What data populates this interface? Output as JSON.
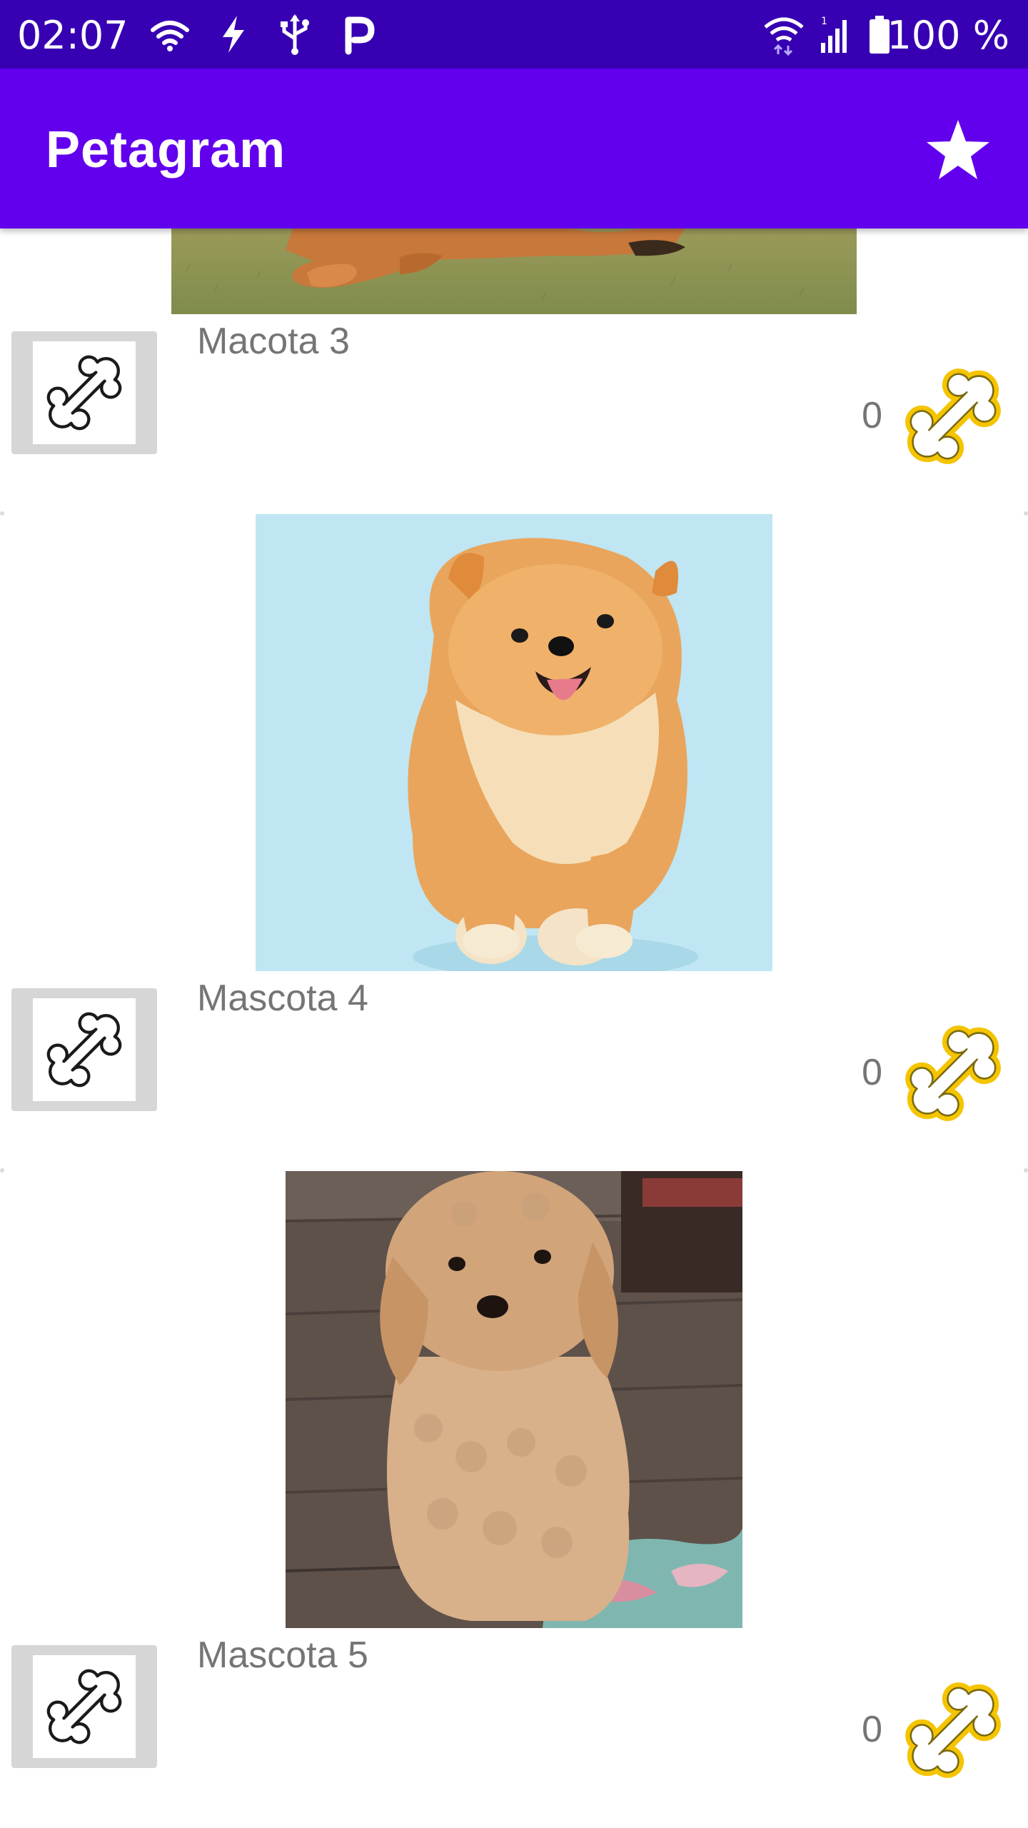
{
  "status_bar": {
    "time": "02:07",
    "battery_percent": "100 %",
    "icons": [
      "wifi-icon",
      "charging-icon",
      "usb-icon",
      "parking-app-icon",
      "wifi-data-icon",
      "signal-icon",
      "battery-icon"
    ]
  },
  "app_bar": {
    "title": "Petagram",
    "action_icon": "star-icon"
  },
  "colors": {
    "status_bar": "#3700b3",
    "app_bar": "#6200ee",
    "bone_gold": "#f5c400",
    "text_gray": "#757575"
  },
  "pets": [
    {
      "name": "Macota 3",
      "likes": "0",
      "photo": "dog-lying-on-grass"
    },
    {
      "name": "Mascota 4",
      "likes": "0",
      "photo": "pomeranian"
    },
    {
      "name": "Mascota 5",
      "likes": "0",
      "photo": "poodle"
    }
  ]
}
